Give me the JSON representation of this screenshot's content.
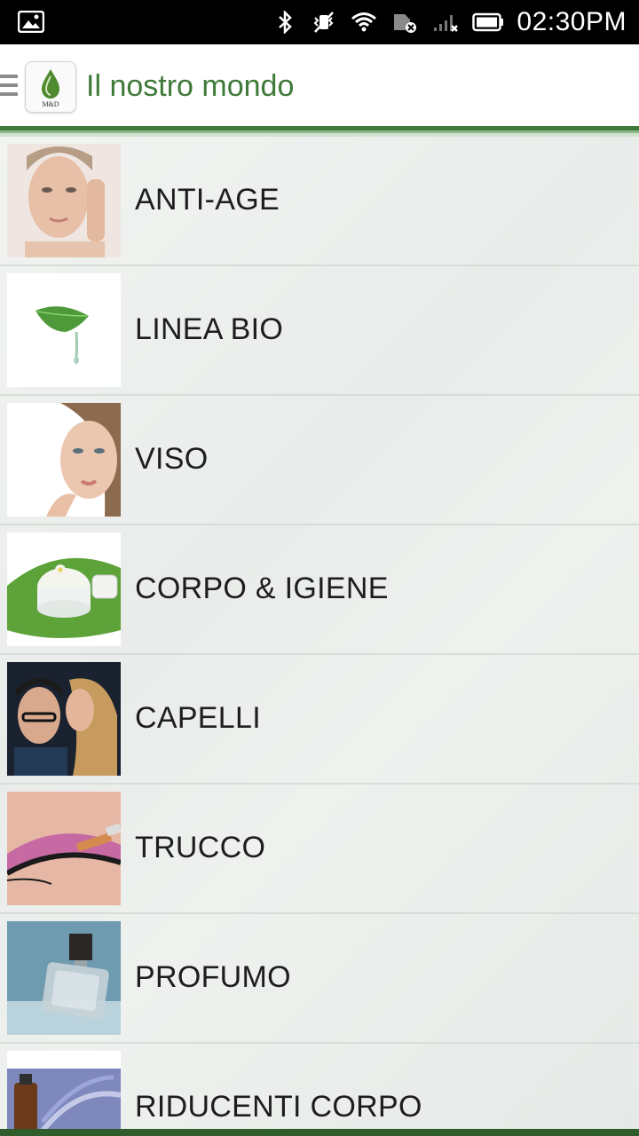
{
  "status_bar": {
    "time": "02:30PM",
    "icons": [
      "image-notification-icon",
      "bluetooth-icon",
      "vibrate-off-icon",
      "wifi-icon",
      "sim-error-icon",
      "signal-off-icon",
      "battery-icon"
    ]
  },
  "app_bar": {
    "title": "Il nostro mondo",
    "logo_text": "M&D",
    "menu_icon": "hamburger-icon"
  },
  "colors": {
    "accent_green": "#3f7a3a",
    "statusbar": "#000000",
    "appbar": "#ffffff"
  },
  "categories": [
    {
      "label": "ANTI-AGE",
      "thumb": "woman-face-cream-photo"
    },
    {
      "label": "LINEA BIO",
      "thumb": "green-leaf-drop-photo"
    },
    {
      "label": "VISO",
      "thumb": "woman-face-beauty-photo"
    },
    {
      "label": "CORPO & IGIENE",
      "thumb": "cream-jar-leaf-photo"
    },
    {
      "label": "CAPELLI",
      "thumb": "couple-portrait-photo"
    },
    {
      "label": "TRUCCO",
      "thumb": "eye-makeup-brush-photo"
    },
    {
      "label": "PROFUMO",
      "thumb": "perfume-bottle-photo"
    },
    {
      "label": "RIDUCENTI CORPO",
      "thumb": "lavender-oil-photo"
    }
  ]
}
